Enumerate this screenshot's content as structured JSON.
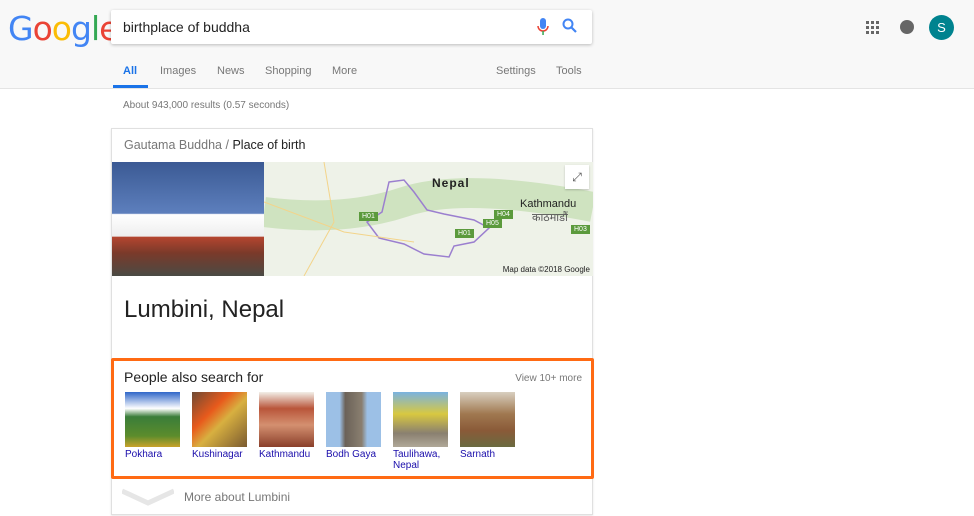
{
  "logo": "Google",
  "search": {
    "query": "birthplace of buddha"
  },
  "tabs": [
    {
      "label": "All"
    },
    {
      "label": "Images"
    },
    {
      "label": "News"
    },
    {
      "label": "Shopping"
    },
    {
      "label": "More"
    }
  ],
  "tools": {
    "settings": "Settings",
    "tools": "Tools"
  },
  "account": {
    "initial": "S",
    "color": "#00838f"
  },
  "result_stats": "About 943,000 results (0.57 seconds)",
  "card": {
    "breadcrumb_parent": "Gautama Buddha",
    "breadcrumb_sep": "/",
    "breadcrumb_current": "Place of birth",
    "map": {
      "label_country": "Nepal",
      "label_city": "Kathmandu",
      "label_city_native": "काठमाडौं",
      "highways": [
        "H01",
        "H04",
        "H05",
        "H01",
        "H03"
      ],
      "credit": "Map data ©2018 Google"
    },
    "title": "Lumbini, Nepal",
    "people_also_search": {
      "heading": "People also search for",
      "view_more": "View 10+ more",
      "highlight_color": "#ff6a13",
      "items": [
        {
          "label": "Pokhara"
        },
        {
          "label": "Kushinagar"
        },
        {
          "label": "Kathmandu"
        },
        {
          "label": "Bodh Gaya"
        },
        {
          "label": "Taulihawa, Nepal"
        },
        {
          "label": "Sarnath"
        }
      ]
    },
    "more_about": "More about Lumbini"
  }
}
